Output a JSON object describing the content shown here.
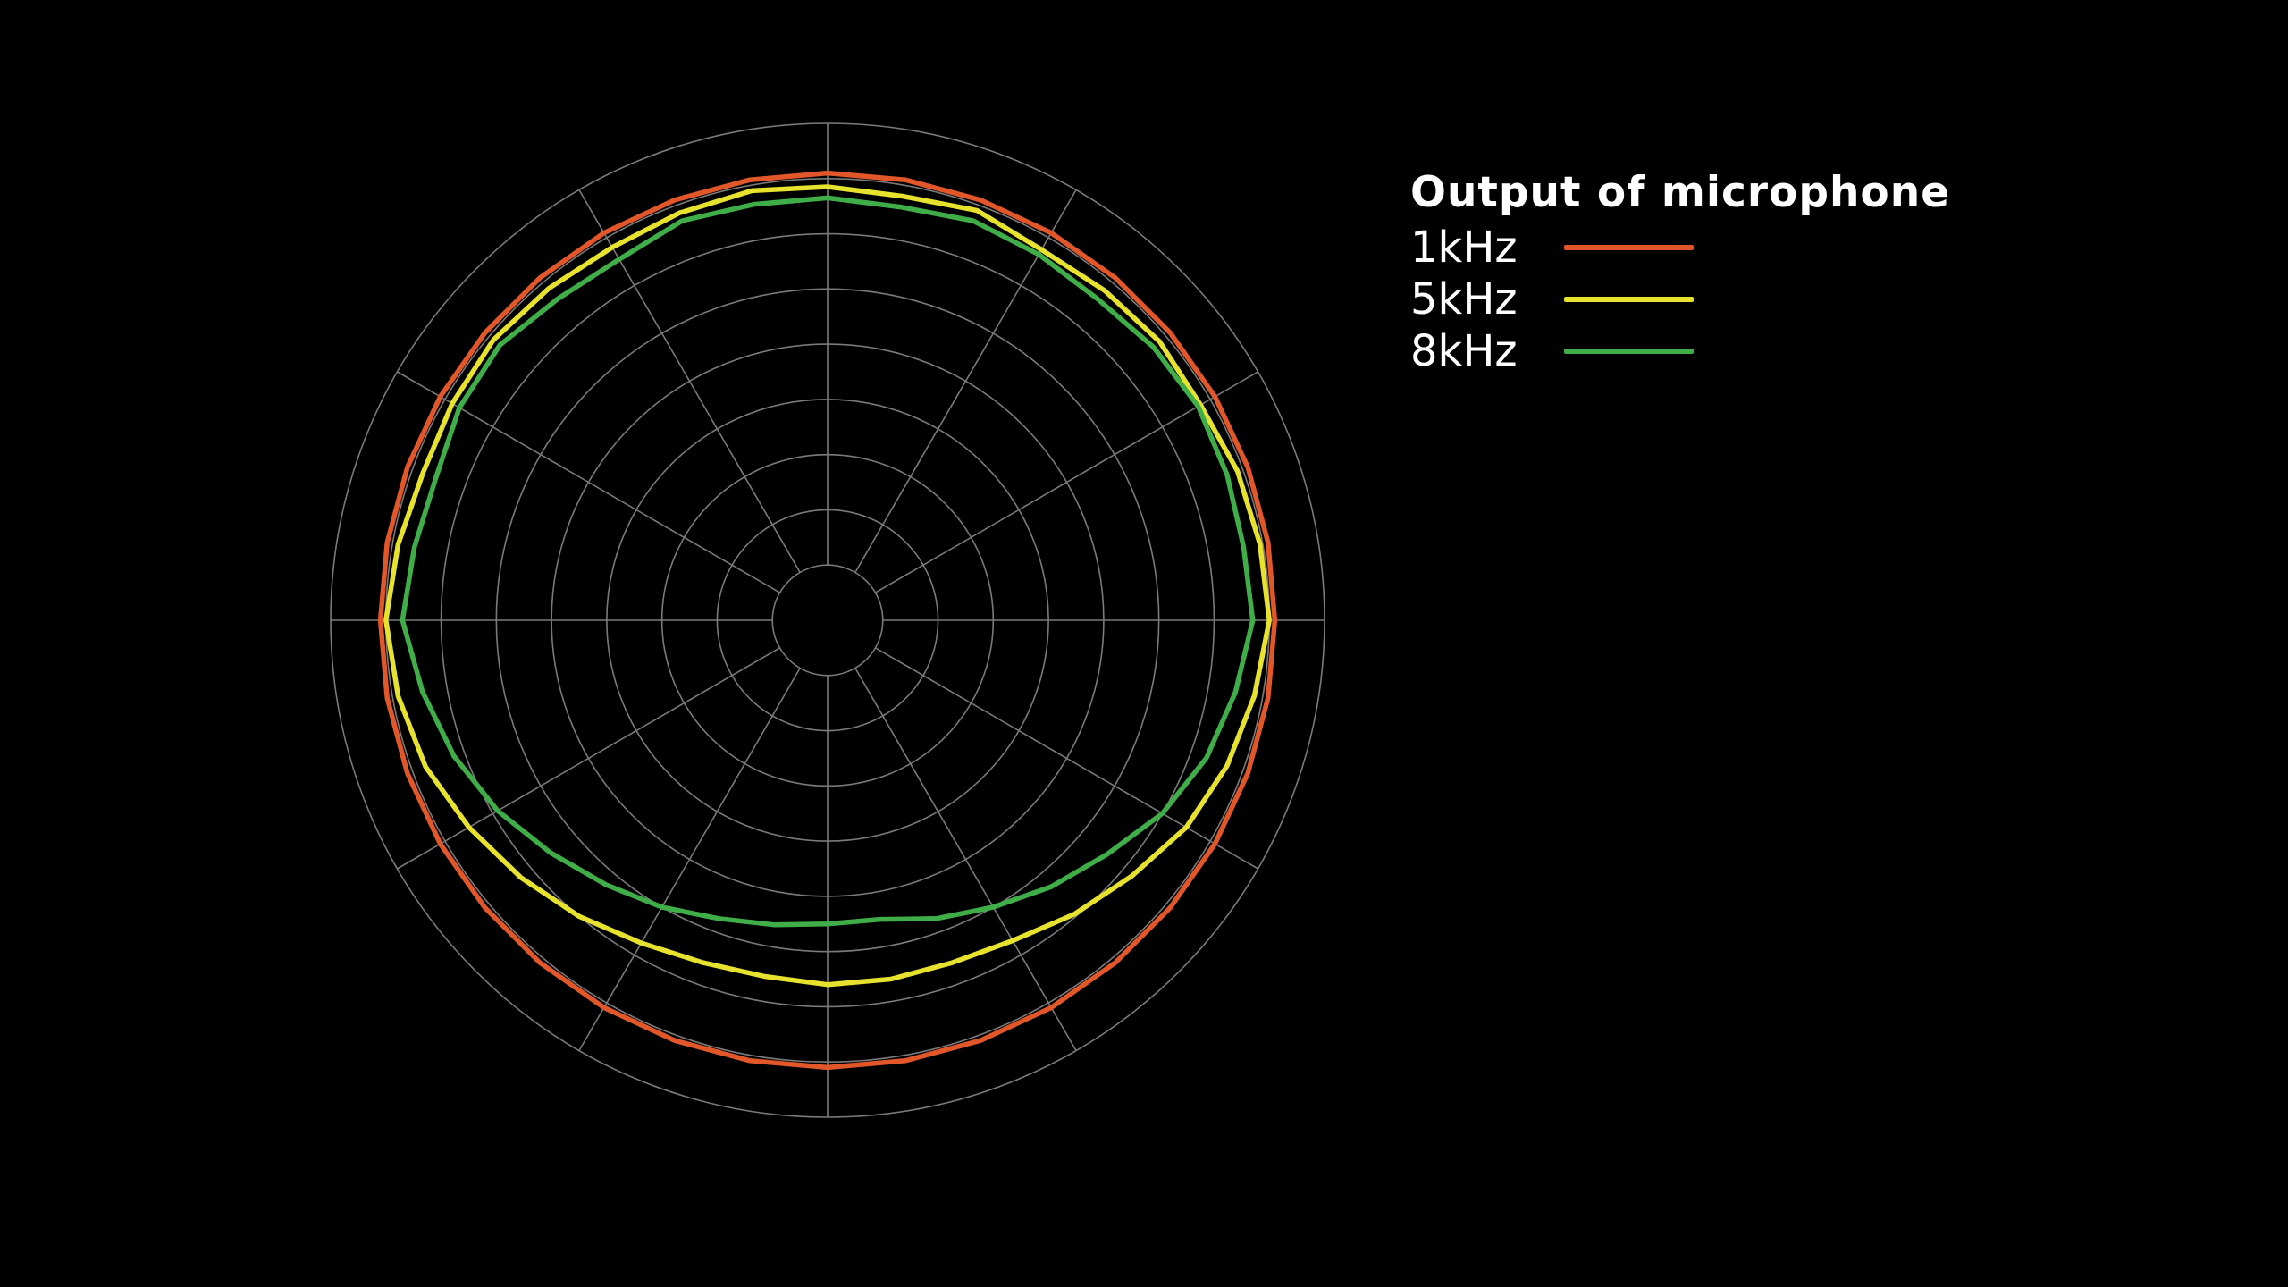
{
  "colors": {
    "background": "#000000",
    "grid": "#7a7a7a",
    "text": "#ffffff"
  },
  "chart_data": {
    "type": "polar",
    "title": "Output of microphone",
    "grid": true,
    "angular_gridlines_deg": [
      0,
      30,
      60,
      90,
      120,
      150,
      180,
      210,
      240,
      270,
      300,
      330
    ],
    "radial_rings": [
      1,
      2,
      3,
      4,
      5,
      6,
      7,
      8,
      9
    ],
    "r_range": [
      0,
      9
    ],
    "legend_position": "top-right",
    "theta": [
      0,
      10,
      20,
      30,
      40,
      50,
      60,
      70,
      80,
      90,
      100,
      110,
      120,
      130,
      140,
      150,
      160,
      170,
      180,
      190,
      200,
      210,
      220,
      230,
      240,
      250,
      260,
      270,
      280,
      290,
      300,
      310,
      320,
      330,
      340,
      350
    ],
    "series": [
      {
        "name": "1kHz",
        "color": "#e2572a",
        "values": [
          8.1,
          8.1,
          8.1,
          8.1,
          8.1,
          8.1,
          8.1,
          8.1,
          8.1,
          8.1,
          8.1,
          8.1,
          8.1,
          8.1,
          8.1,
          8.1,
          8.1,
          8.1,
          8.1,
          8.1,
          8.1,
          8.1,
          8.1,
          8.1,
          8.1,
          8.1,
          8.1,
          8.1,
          8.1,
          8.1,
          8.1,
          8.1,
          8.1,
          8.1,
          8.1,
          8.1
        ]
      },
      {
        "name": "5kHz",
        "color": "#e6e22e",
        "values": [
          7.85,
          7.8,
          7.9,
          7.75,
          7.8,
          7.85,
          7.8,
          7.9,
          7.95,
          8.0,
          7.85,
          7.7,
          7.5,
          7.2,
          6.95,
          6.7,
          6.6,
          6.6,
          6.6,
          6.55,
          6.6,
          6.75,
          7.0,
          7.25,
          7.5,
          7.75,
          7.9,
          8.0,
          7.9,
          7.8,
          7.85,
          7.9,
          7.85,
          7.8,
          7.85,
          7.9
        ]
      },
      {
        "name": "8kHz",
        "color": "#3fae49",
        "values": [
          7.65,
          7.6,
          7.7,
          7.65,
          7.6,
          7.7,
          7.75,
          7.7,
          7.65,
          7.7,
          7.5,
          7.3,
          7.0,
          6.6,
          6.3,
          6.0,
          5.75,
          5.5,
          5.5,
          5.6,
          5.75,
          6.0,
          6.25,
          6.55,
          6.9,
          7.2,
          7.45,
          7.7,
          7.6,
          7.55,
          7.7,
          7.75,
          7.6,
          7.55,
          7.7,
          7.65
        ]
      }
    ]
  }
}
